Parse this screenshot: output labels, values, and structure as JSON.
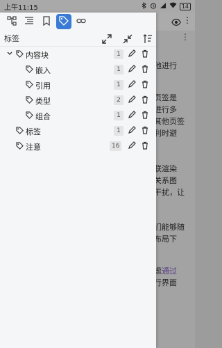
{
  "status": {
    "time": "上午11:15",
    "battery": "14"
  },
  "toolbar": {
    "eye_icon": "eye-icon",
    "more": "⋮"
  },
  "background_text": [
    "他进行",
    "页签是",
    "进行多",
    "其他页签",
    "利时避",
    "联渲染",
    "关系图",
    "干扰，让",
    "们能够随",
    "布局下",
    "虑",
    "通过",
    "行界面"
  ],
  "tabs": [
    {
      "name": "outline",
      "icon": "outline-icon",
      "active": false
    },
    {
      "name": "list",
      "icon": "list-icon",
      "active": false
    },
    {
      "name": "bookmark",
      "icon": "bookmark-icon",
      "active": false
    },
    {
      "name": "tag",
      "icon": "tag-icon",
      "active": true
    },
    {
      "name": "link",
      "icon": "link-icon",
      "active": false
    }
  ],
  "panel": {
    "title": "标签",
    "actions": [
      "expand-icon",
      "collapse-icon",
      "sort-icon"
    ],
    "more": "⋮"
  },
  "tree": [
    {
      "label": "内容块",
      "count": "1",
      "level": 0,
      "expanded": true
    },
    {
      "label": "嵌入",
      "count": "1",
      "level": 1
    },
    {
      "label": "引用",
      "count": "1",
      "level": 1
    },
    {
      "label": "类型",
      "count": "2",
      "level": 1
    },
    {
      "label": "组合",
      "count": "1",
      "level": 1
    },
    {
      "label": "标签",
      "count": "1",
      "level": 0
    },
    {
      "label": "注意",
      "count": "16",
      "level": 0
    }
  ]
}
